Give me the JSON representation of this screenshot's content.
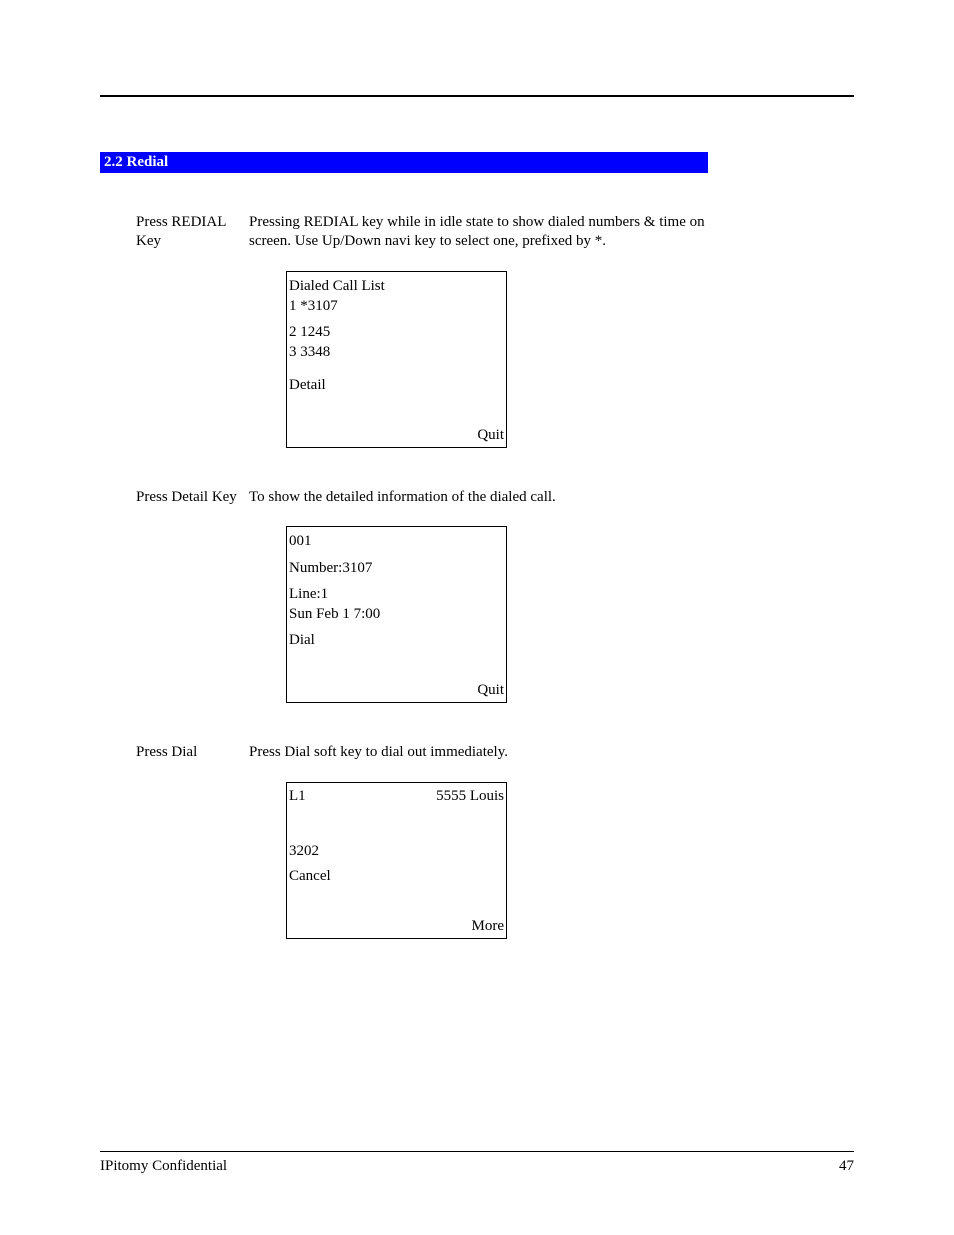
{
  "section": {
    "header": "2.2 Redial"
  },
  "steps": {
    "step1": {
      "label": "Press REDIAL Key",
      "desc": "Pressing REDIAL key while in idle state to show dialed numbers & time on screen. Use Up/Down navi key to select one, prefixed by *."
    },
    "step2": {
      "label": "Press Detail Key",
      "desc": "To show the detailed information of the dialed call."
    },
    "step3": {
      "label": "Press Dial",
      "desc": "Press Dial soft key to dial out immediately."
    }
  },
  "lcd1": {
    "title": "Dialed Call List",
    "row1": "1 *3107",
    "row2": "2   1245",
    "row3": "3   3348",
    "leftkey": "Detail",
    "rightkey": "Quit"
  },
  "lcd2": {
    "row1": "001",
    "row2": "Number:3107",
    "row3": "Line:1",
    "row4": "Sun Feb 1 7:00",
    "leftkey": "Dial",
    "rightkey": "Quit"
  },
  "lcd3": {
    "top_left": "L1",
    "top_right": "5555   Louis",
    "mid": "3202",
    "leftkey": "Cancel",
    "rightkey": "More"
  },
  "footer": {
    "left": "IPitomy Confidential",
    "right": "47"
  }
}
